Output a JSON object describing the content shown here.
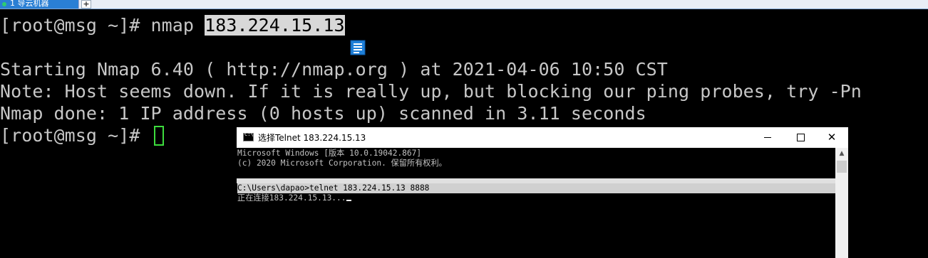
{
  "tabs": {
    "active_label": "1 导云机器",
    "add_label": "+"
  },
  "terminal": {
    "line1_prompt": "[root@msg ~]# nmap ",
    "line1_selected": "183.224.15.13",
    "line2": "Starting Nmap 6.40 ( http://nmap.org ) at 2021-04-06 10:50 CST",
    "line3": "Note: Host seems down. If it is really up, but blocking our ping probes, try -Pn",
    "line4": "Nmap done: 1 IP address (0 hosts up) scanned in 3.11 seconds",
    "line5_prompt": "[root@msg ~]# "
  },
  "telnet_window": {
    "icon_text": "C:\\",
    "title": "选择Telnet 183.224.15.13",
    "minimize": "–",
    "maximize": "□",
    "close": "✕",
    "lines": [
      "Microsoft Windows [版本 10.0.19042.867]",
      "(c) 2020 Microsoft Corporation. 保留所有权利。",
      "C:\\Users\\dapao>telnet 183.224.15.13 8888",
      "正在连接183.224.15.13..."
    ],
    "scroll_up": "▲"
  },
  "colors": {
    "terminal_bg": "#000000",
    "terminal_fg": "#c7c7c7",
    "cursor": "#3ddc3d",
    "tab_active": "#2a7fd4"
  }
}
